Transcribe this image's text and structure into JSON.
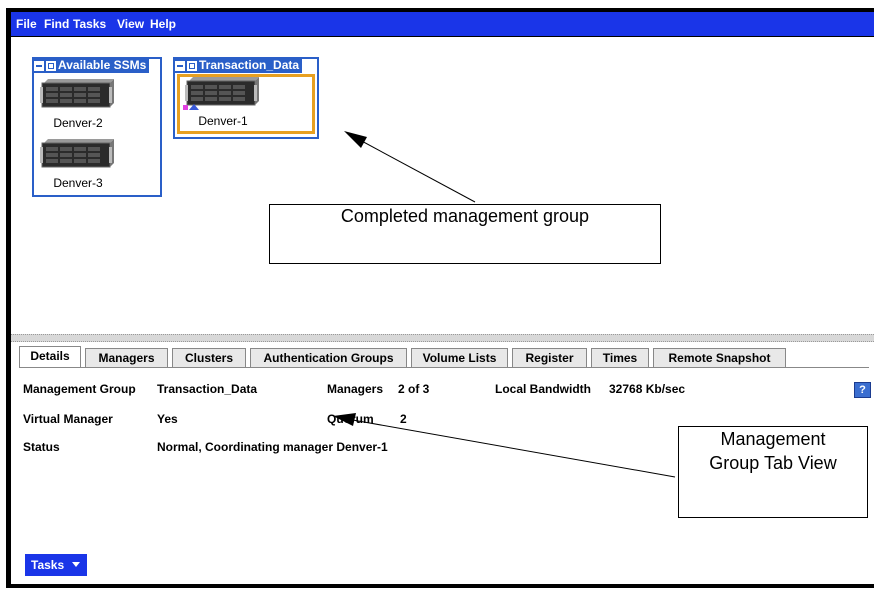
{
  "menu": {
    "items": [
      {
        "label": "File"
      },
      {
        "label": "Find"
      },
      {
        "label": "Tasks"
      },
      {
        "label": "View"
      },
      {
        "label": "Help"
      }
    ]
  },
  "groups": {
    "available": {
      "title": "Available SSMs",
      "nodes": [
        "Denver-2",
        "Denver-3"
      ]
    },
    "transaction": {
      "title": "Transaction_Data",
      "nodes": [
        "Denver-1"
      ]
    }
  },
  "tabs": [
    "Details",
    "Managers",
    "Clusters",
    "Authentication Groups",
    "Volume Lists",
    "Register",
    "Times",
    "Remote Snapshot"
  ],
  "details": {
    "mg_label": "Management Group",
    "mg_value": "Transaction_Data",
    "managers_label": "Managers",
    "managers_value": "2 of 3",
    "bandwidth_label": "Local Bandwidth",
    "bandwidth_value": "32768 Kb/sec",
    "vm_label": "Virtual Manager",
    "vm_value": "Yes",
    "quorum_label": "Quorum",
    "quorum_value": "2",
    "status_label": "Status",
    "status_value": "Normal, Coordinating manager Denver-1",
    "help": "?"
  },
  "tasks_button": "Tasks",
  "callouts": {
    "top": "Completed management group",
    "bottom_line1": "Management",
    "bottom_line2": "Group Tab View"
  },
  "colors": {
    "menubar": "#1a35e8",
    "group_border": "#2a5fc8",
    "selected_border": "#e8a020"
  }
}
